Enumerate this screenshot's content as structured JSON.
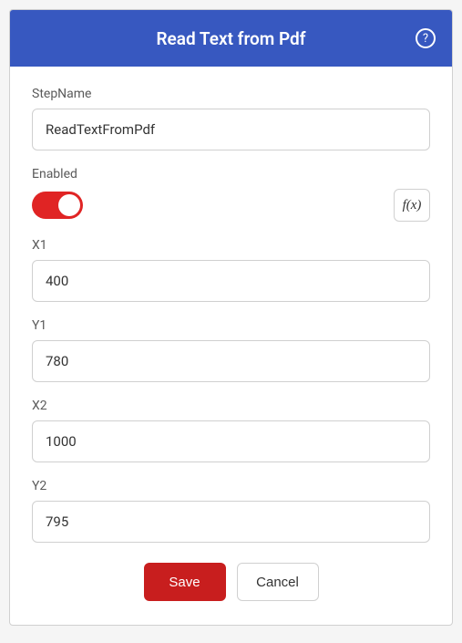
{
  "header": {
    "title": "Read Text from Pdf"
  },
  "fields": {
    "stepname": {
      "label": "StepName",
      "value": "ReadTextFromPdf"
    },
    "enabled": {
      "label": "Enabled",
      "fx_label": "f(x)"
    },
    "x1": {
      "label": "X1",
      "value": "400"
    },
    "y1": {
      "label": "Y1",
      "value": "780"
    },
    "x2": {
      "label": "X2",
      "value": "1000"
    },
    "y2": {
      "label": "Y2",
      "value": "795"
    }
  },
  "buttons": {
    "save": "Save",
    "cancel": "Cancel"
  }
}
